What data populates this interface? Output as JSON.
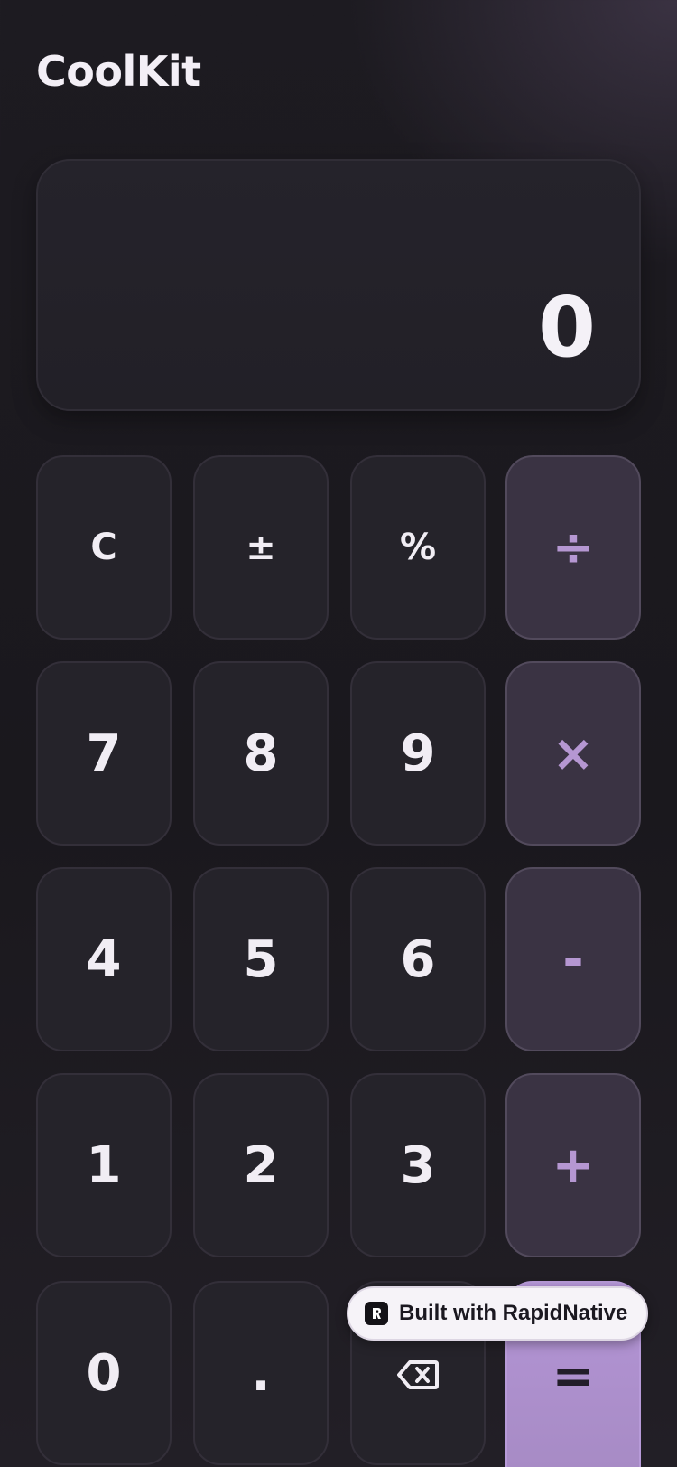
{
  "app": {
    "title": "CoolKit"
  },
  "display": {
    "value": "0"
  },
  "keypad": {
    "rows": [
      [
        {
          "label": "C",
          "kind": "func",
          "name": "clear-button"
        },
        {
          "label": "±",
          "kind": "func",
          "name": "sign-toggle-button"
        },
        {
          "label": "%",
          "kind": "func",
          "name": "percent-button"
        },
        {
          "label": "÷",
          "kind": "op",
          "name": "divide-button"
        }
      ],
      [
        {
          "label": "7",
          "kind": "num",
          "name": "digit-7-button"
        },
        {
          "label": "8",
          "kind": "num",
          "name": "digit-8-button"
        },
        {
          "label": "9",
          "kind": "num",
          "name": "digit-9-button"
        },
        {
          "label": "×",
          "kind": "op",
          "name": "multiply-button"
        }
      ],
      [
        {
          "label": "4",
          "kind": "num",
          "name": "digit-4-button"
        },
        {
          "label": "5",
          "kind": "num",
          "name": "digit-5-button"
        },
        {
          "label": "6",
          "kind": "num",
          "name": "digit-6-button"
        },
        {
          "label": "-",
          "kind": "op",
          "name": "subtract-button"
        }
      ],
      [
        {
          "label": "1",
          "kind": "num",
          "name": "digit-1-button"
        },
        {
          "label": "2",
          "kind": "num",
          "name": "digit-2-button"
        },
        {
          "label": "3",
          "kind": "num",
          "name": "digit-3-button"
        },
        {
          "label": "+",
          "kind": "op",
          "name": "add-button"
        }
      ],
      [
        {
          "label": "0",
          "kind": "num",
          "name": "digit-0-button"
        },
        {
          "label": ".",
          "kind": "num",
          "name": "decimal-button"
        },
        {
          "label": "",
          "kind": "icon",
          "icon": "backspace-icon",
          "name": "backspace-button"
        },
        {
          "label": "=",
          "kind": "eq",
          "name": "equals-button"
        }
      ]
    ]
  },
  "badge": {
    "text": "Built with RapidNative",
    "icon": "rapidnative-logo-icon"
  },
  "colors": {
    "background": "#1c1a20",
    "key": "#25232a",
    "operator_key": "#3a3343",
    "operator_text": "#b597d2",
    "equals_key": "#b093d2"
  }
}
